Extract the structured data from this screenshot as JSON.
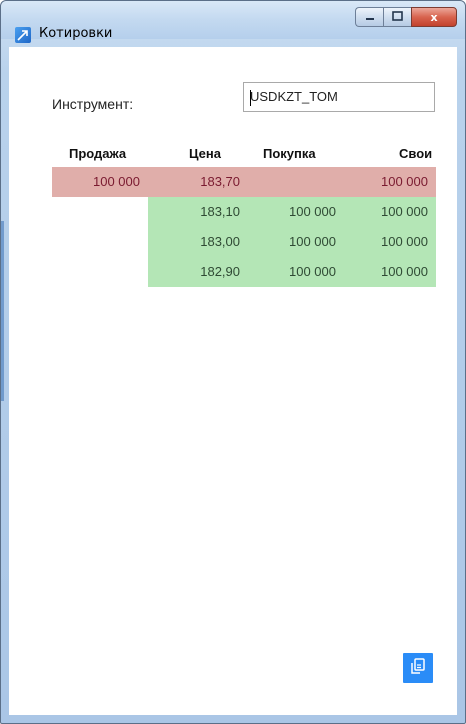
{
  "window": {
    "title": "Котировки",
    "controls": {
      "minimize": "–",
      "maximize": "□",
      "close": "x"
    }
  },
  "instrument": {
    "label": "Инструмент:",
    "value": "USDKZT_TOM"
  },
  "table": {
    "headers": [
      "Продажа",
      "Цена",
      "Покупка",
      "Свои"
    ],
    "sell_rows": [
      {
        "sell": "100 000",
        "price": "183,70",
        "buy": "",
        "own": "100 000"
      }
    ],
    "buy_rows": [
      {
        "sell": "",
        "price": "183,10",
        "buy": "100 000",
        "own": "100 000"
      },
      {
        "sell": "",
        "price": "183,00",
        "buy": "100 000",
        "own": "100 000"
      },
      {
        "sell": "",
        "price": "182,90",
        "buy": "100 000",
        "own": "100 000"
      }
    ]
  },
  "icons": {
    "app": "chart-arrow-icon",
    "copy": "copy-icon"
  },
  "colors": {
    "sell_bg": "#e0aeaa",
    "buy_bg": "#b4e6b6",
    "accent": "#2a8cf7"
  }
}
